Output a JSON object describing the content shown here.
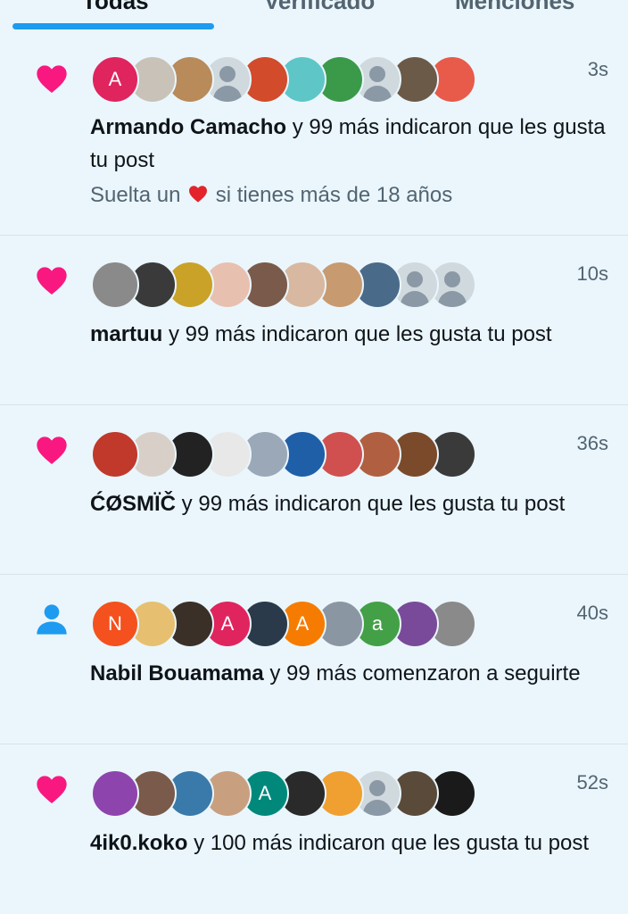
{
  "tabs": [
    {
      "label": "Todas",
      "active": true
    },
    {
      "label": "Verificado",
      "active": false
    },
    {
      "label": "Menciones",
      "active": false
    }
  ],
  "accent_color": "#1d9bf0",
  "like_color": "#f91880",
  "notifications": [
    {
      "type": "like",
      "icon": "heart-icon",
      "time": "3s",
      "user": "Armando Camacho",
      "message": "y 99 más indicaron que les gusta tu post",
      "preview_before": "Suelta un",
      "preview_emoji": "red-heart-emoji",
      "preview_after": "si tienes más de 18 años",
      "avatars": [
        {
          "letter": "A",
          "color": "#e0245e"
        },
        {
          "letter": "",
          "color": "#c8c2b8"
        },
        {
          "letter": "",
          "color": "#b98a5a"
        },
        {
          "letter": "",
          "color": "default"
        },
        {
          "letter": "",
          "color": "#d24b2a"
        },
        {
          "letter": "",
          "color": "#5ec6c7"
        },
        {
          "letter": "",
          "color": "#3a9a4a"
        },
        {
          "letter": "",
          "color": "default"
        },
        {
          "letter": "",
          "color": "#6b5a48"
        },
        {
          "letter": "",
          "color": "#e85a4a"
        }
      ]
    },
    {
      "type": "like",
      "icon": "heart-icon",
      "time": "10s",
      "user": "martuu",
      "message": "y 99 más indicaron que les gusta tu post",
      "avatars": [
        {
          "letter": "",
          "color": "#8a8a8a"
        },
        {
          "letter": "",
          "color": "#3a3a3a"
        },
        {
          "letter": "",
          "color": "#c9a227"
        },
        {
          "letter": "",
          "color": "#e8c0b0"
        },
        {
          "letter": "",
          "color": "#7a5a4a"
        },
        {
          "letter": "",
          "color": "#d8b8a0"
        },
        {
          "letter": "",
          "color": "#c89a70"
        },
        {
          "letter": "",
          "color": "#4a6a8a"
        },
        {
          "letter": "",
          "color": "default"
        },
        {
          "letter": "",
          "color": "default"
        }
      ]
    },
    {
      "type": "like",
      "icon": "heart-icon",
      "time": "36s",
      "user": "ĆØSMÏČ",
      "message": "y 99 más indicaron que les gusta tu post",
      "avatars": [
        {
          "letter": "",
          "color": "#c0392b"
        },
        {
          "letter": "",
          "color": "#d8d0c8"
        },
        {
          "letter": "",
          "color": "#222222"
        },
        {
          "letter": "",
          "color": "#e8e8e8"
        },
        {
          "letter": "",
          "color": "#9aa8b8"
        },
        {
          "letter": "",
          "color": "#1f5fa8"
        },
        {
          "letter": "",
          "color": "#d05050"
        },
        {
          "letter": "",
          "color": "#b06040"
        },
        {
          "letter": "",
          "color": "#7a4a2a"
        },
        {
          "letter": "",
          "color": "#3a3a3a"
        }
      ]
    },
    {
      "type": "follow",
      "icon": "person-icon",
      "time": "40s",
      "user": "Nabil Bouamama",
      "message": "y 99 más comenzaron a seguirte",
      "avatars": [
        {
          "letter": "N",
          "color": "#f4511e"
        },
        {
          "letter": "",
          "color": "#e6c070"
        },
        {
          "letter": "",
          "color": "#3a3028"
        },
        {
          "letter": "A",
          "color": "#e0245e"
        },
        {
          "letter": "",
          "color": "#2a3a4a"
        },
        {
          "letter": "A",
          "color": "#f57c00"
        },
        {
          "letter": "",
          "color": "#8a96a2"
        },
        {
          "letter": "a",
          "color": "#43a047"
        },
        {
          "letter": "",
          "color": "#7a4a9a"
        },
        {
          "letter": "",
          "color": "#8a8a8a"
        }
      ]
    },
    {
      "type": "like",
      "icon": "heart-icon",
      "time": "52s",
      "user": "4ik0.koko",
      "message": "y 100 más indicaron que les gusta tu post",
      "avatars": [
        {
          "letter": "",
          "color": "#8e44ad"
        },
        {
          "letter": "",
          "color": "#7a5a4a"
        },
        {
          "letter": "",
          "color": "#3a7aaa"
        },
        {
          "letter": "",
          "color": "#c8a080"
        },
        {
          "letter": "A",
          "color": "#00897b"
        },
        {
          "letter": "",
          "color": "#2a2a2a"
        },
        {
          "letter": "",
          "color": "#f0a030"
        },
        {
          "letter": "",
          "color": "default"
        },
        {
          "letter": "",
          "color": "#5a4a3a"
        },
        {
          "letter": "",
          "color": "#1a1a1a"
        }
      ]
    }
  ]
}
